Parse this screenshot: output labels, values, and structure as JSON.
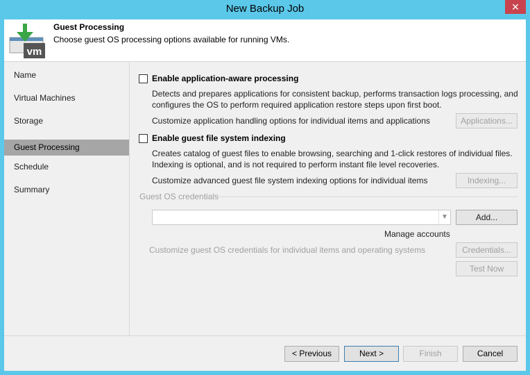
{
  "window": {
    "title": "New Backup Job",
    "close": "✕"
  },
  "header": {
    "title": "Guest Processing",
    "subtitle": "Choose guest OS processing options available for running VMs.",
    "logo_text": "vm"
  },
  "sidebar": {
    "items": [
      {
        "label": "Name",
        "active": false
      },
      {
        "label": "Virtual Machines",
        "active": false
      },
      {
        "label": "Storage",
        "active": false
      },
      {
        "label": "Guest Processing",
        "active": true
      },
      {
        "label": "Schedule",
        "active": false
      },
      {
        "label": "Summary",
        "active": false
      }
    ]
  },
  "content": {
    "app_aware": {
      "label": "Enable application-aware processing",
      "checked": false,
      "desc_line1": "Detects and prepares applications for consistent backup, performs transaction logs processing, and",
      "desc_line2": "configures the OS to perform required application restore steps upon first boot.",
      "customize": "Customize application handling options for individual items and applications",
      "button": "Applications..."
    },
    "indexing": {
      "label": "Enable guest file system indexing",
      "checked": false,
      "desc_line1": "Creates catalog of guest files to enable browsing, searching and 1-click restores of individual files.",
      "desc_line2": "Indexing is optional, and is not required to perform instant file level recoveries.",
      "customize": "Customize advanced guest file system indexing options for individual items",
      "button": "Indexing..."
    },
    "credentials": {
      "group_label": "Guest OS credentials",
      "selected": "",
      "add_button": "Add...",
      "manage_link": "Manage accounts",
      "customize": "Customize guest OS credentials for individual items and operating systems",
      "credentials_button": "Credentials...",
      "test_button": "Test Now"
    }
  },
  "footer": {
    "previous": "< Previous",
    "next": "Next >",
    "finish": "Finish",
    "cancel": "Cancel"
  },
  "colors": {
    "titlebar": "#5bc8ea",
    "close": "#c8434d",
    "active_item": "#a6a6a6",
    "logo_green": "#3aa647"
  }
}
